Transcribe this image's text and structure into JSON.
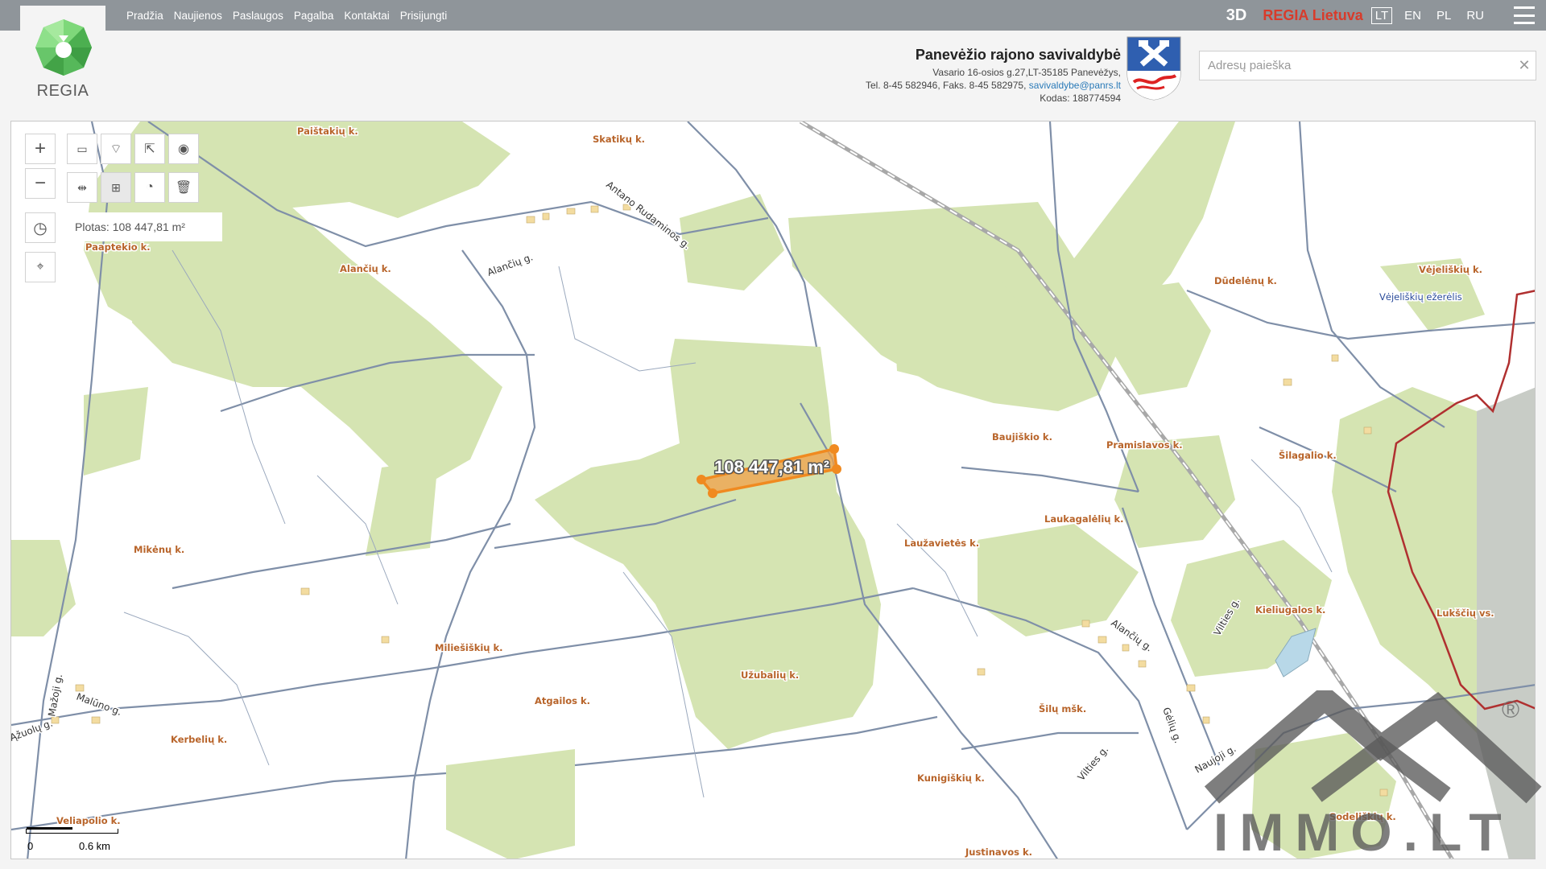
{
  "nav": {
    "items": [
      "Pradžia",
      "Naujienos",
      "Paslaugos",
      "Pagalba",
      "Kontaktai",
      "Prisijungti"
    ],
    "btn_3d": "3D",
    "regia_lietuva": "REGIA Lietuva",
    "languages": [
      "LT",
      "EN",
      "PL",
      "RU"
    ],
    "active_language": "LT"
  },
  "logo": {
    "text": "REGIA"
  },
  "municipality": {
    "title": "Panevėžio rajono savivaldybė",
    "address": "Vasario 16-osios g.27,LT-35185 Panevėžys,",
    "phone_prefix": "Tel. 8-45 582946, Faks. 8-45 582975,",
    "email": "savivaldybe@panrs.lt",
    "code": "Kodas: 188774594"
  },
  "search": {
    "placeholder": "Adresų paieška",
    "value": ""
  },
  "map_tools": {
    "area_label": "Plotas: 108 447,81 m²",
    "parcel_label": "108 447,81 m²",
    "scale_zero": "0",
    "scale_distance": "0.6 km"
  },
  "place_labels": [
    "Paištakių k.",
    "Skatikų k.",
    "Paaptekio k.",
    "Alančių k.",
    "Dūdelėnų k.",
    "Vėjeliškių k.",
    "Vėjeliškių ežerėlis",
    "Baujiškio k.",
    "Pramislavos k.",
    "Šilagalio k.",
    "Laukagalėlių k.",
    "Laužavietės k.",
    "Mikėnų k.",
    "Kieliugalos k.",
    "Lukščių vs.",
    "Miliešiškių k.",
    "Atgailos k.",
    "Užubalių k.",
    "Šilų mšk.",
    "Kerbelių k.",
    "Kunigiškių k.",
    "Veliapolio k.",
    "Sodeliškių k.",
    "Justinavos k."
  ],
  "road_labels": [
    "Alančių g.",
    "Antano Rudaminos g.",
    "Alančių g.",
    "Vilties g.",
    "Malūno g.",
    "Ąžuolų g.",
    "Mažoji g.",
    "Gėlių g.",
    "Naujoji g.",
    "Vilties g."
  ],
  "watermark": {
    "text": "IMMO.LT",
    "reg": "®"
  },
  "colors": {
    "topbar": "#8f959a",
    "forest": "#d5e4b2",
    "parcel": "#f0a048",
    "boundary": "#b03030",
    "roads": "#7f8fa8",
    "labels": "#b8642a"
  }
}
